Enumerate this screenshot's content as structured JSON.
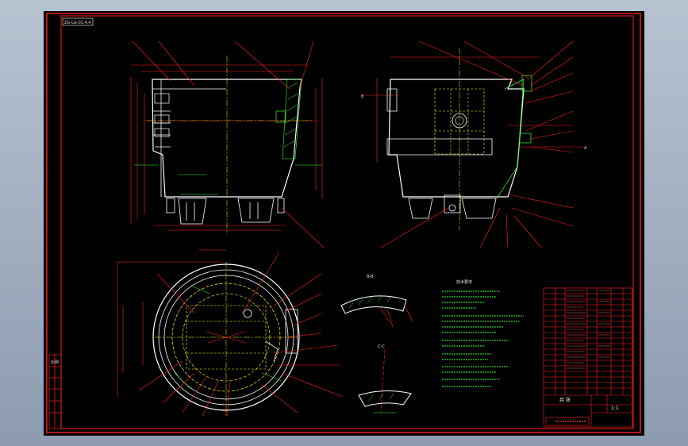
{
  "viewport": {
    "background": "#000000"
  },
  "sheet": {
    "border_color": "#ff2020",
    "corner_tag": "ZG-LG-01.4.4"
  },
  "colors": {
    "outline": "#ffffff",
    "leader": "#ff2020",
    "dimension": "#ff2020",
    "hatch": "#33ff33",
    "centerline": "#ffff00",
    "body": "#000000"
  },
  "views": {
    "front": {
      "name": "front-elevation"
    },
    "side": {
      "name": "side-elevation",
      "section_label_left": "B",
      "section_label_right": "A"
    },
    "plan": {
      "name": "plan-view"
    },
    "detail_top": {
      "label": "B-B"
    },
    "detail_bottom": {
      "label": "C-C"
    }
  },
  "notes": {
    "title": "技术要求"
  },
  "left_strip": {
    "label": "比例"
  },
  "title_block": {
    "scale": "1:1",
    "sheet": "共 张"
  },
  "icons": [
    "cad-border-icon",
    "leader-arrow-icon"
  ]
}
